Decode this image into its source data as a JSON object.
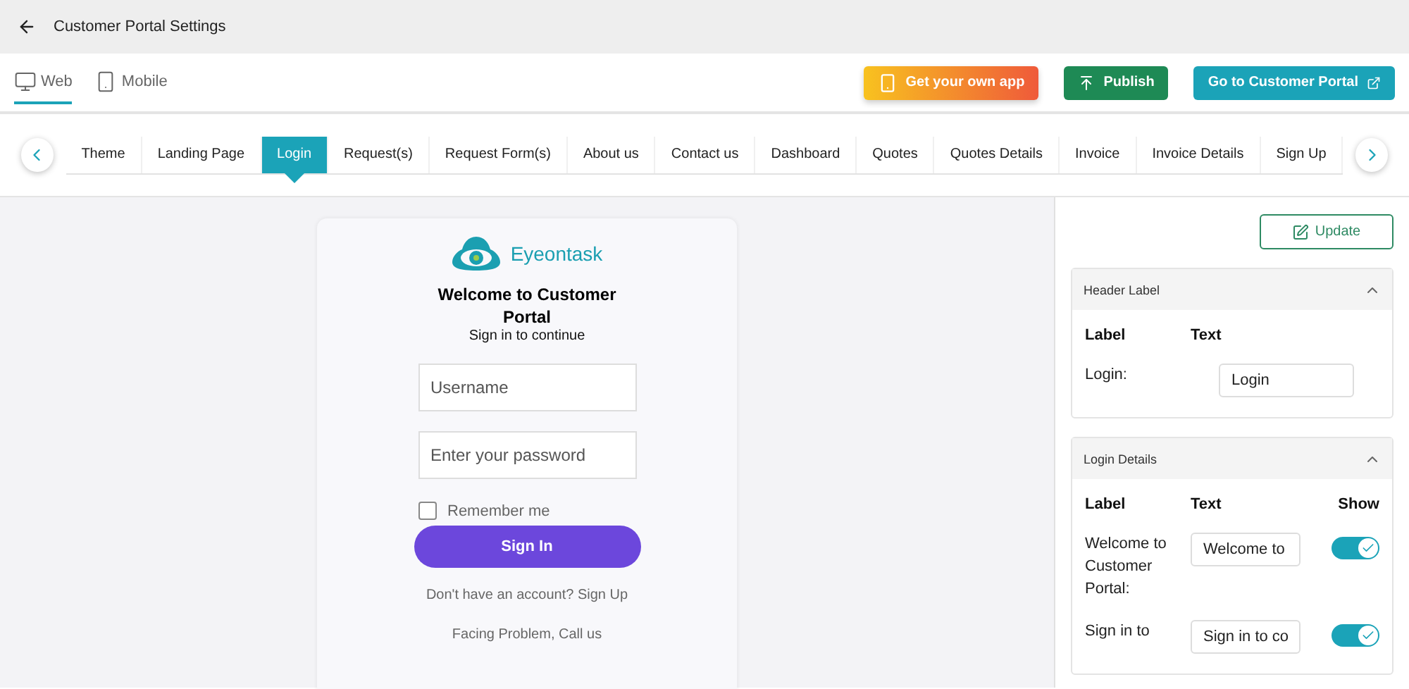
{
  "header": {
    "title": "Customer Portal Settings"
  },
  "view_tabs": [
    {
      "label": "Web",
      "kind": "monitor",
      "selected": true
    },
    {
      "label": "Mobile",
      "kind": "phone",
      "selected": false
    }
  ],
  "actions": [
    {
      "label": "Get your own app",
      "kind": "app"
    },
    {
      "label": "Publish",
      "kind": "publish"
    },
    {
      "label": "Go to Customer Portal",
      "kind": "portal"
    }
  ],
  "page_tabs": [
    {
      "label": "Theme",
      "selected": false
    },
    {
      "label": "Landing Page",
      "selected": false
    },
    {
      "label": "Login",
      "selected": true
    },
    {
      "label": "Request(s)",
      "selected": false
    },
    {
      "label": "Request Form(s)",
      "selected": false
    },
    {
      "label": "About us",
      "selected": false
    },
    {
      "label": "Contact us",
      "selected": false
    },
    {
      "label": "Dashboard",
      "selected": false
    },
    {
      "label": "Quotes",
      "selected": false
    },
    {
      "label": "Quotes Details",
      "selected": false
    },
    {
      "label": "Invoice",
      "selected": false
    },
    {
      "label": "Invoice Details",
      "selected": false
    },
    {
      "label": "Sign Up",
      "selected": false
    }
  ],
  "preview": {
    "brand": "Eyeontask",
    "title": "Welcome to Customer Portal",
    "subtitle": "Sign in to continue",
    "username_placeholder": "Username",
    "password_placeholder": "Enter your password",
    "remember": {
      "label": "Remember me",
      "checked": false
    },
    "button": "Sign In",
    "signup": "Don't have an account? Sign Up",
    "help": "Facing Problem, Call us"
  },
  "panel": {
    "update": "Update",
    "sections": [
      {
        "title": "Header Label",
        "expanded": true,
        "columns": [
          "Label",
          "Text"
        ],
        "rows": [
          {
            "label": "Login:",
            "value": "Login"
          }
        ]
      },
      {
        "title": "Login Details",
        "expanded": true,
        "columns": [
          "Label",
          "Text",
          "Show"
        ],
        "rows": [
          {
            "label": "Welcome to Customer Portal:",
            "value": "Welcome to",
            "show": true
          },
          {
            "label": "Sign in to",
            "value": "Sign in to co",
            "show": true
          }
        ]
      }
    ]
  }
}
